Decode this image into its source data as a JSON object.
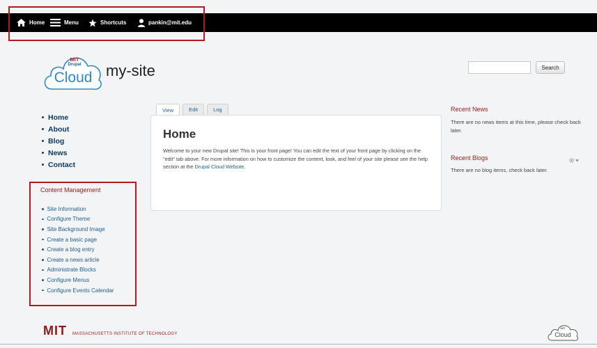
{
  "toolbar": {
    "home_label": "Home",
    "menu_label": "Menu",
    "shortcuts_label": "Shortcuts",
    "user_label": "pankin@mit.edu"
  },
  "site": {
    "logo_top": "MIT",
    "logo_mid": "Drupal",
    "logo_main": "Cloud",
    "name": "my-site"
  },
  "search": {
    "value": "",
    "placeholder": "",
    "button_label": "Search"
  },
  "main_nav": {
    "items": [
      {
        "label": "Home"
      },
      {
        "label": "About"
      },
      {
        "label": "Blog"
      },
      {
        "label": "News"
      },
      {
        "label": "Contact"
      }
    ]
  },
  "content_management": {
    "title": "Content Management",
    "items": [
      {
        "label": "Site Information"
      },
      {
        "label": "Configure Theme"
      },
      {
        "label": "Site Background Image"
      },
      {
        "label": "Create a basic page"
      },
      {
        "label": "Create a blog entry"
      },
      {
        "label": "Create a news article"
      },
      {
        "label": "Administrate Blocks"
      },
      {
        "label": "Configure Menus"
      },
      {
        "label": "Configure Events Calendar"
      }
    ]
  },
  "tabs": [
    {
      "label": "View",
      "active": true
    },
    {
      "label": "Edit",
      "active": false
    },
    {
      "label": "Log",
      "active": false
    }
  ],
  "page": {
    "title": "Home",
    "body_before_link": "Welcome to your new Drupal site! This is your front page! You can edit the text of your front page by clicking on the \"edit\" tab above. For more information on how to customize the content, look, and feel of your site please see the help section at the ",
    "body_link": "Drupal Cloud Website",
    "body_after_link": "."
  },
  "recent_news": {
    "title": "Recent News",
    "text": "There are no news items at this time, please check back later."
  },
  "recent_blogs": {
    "title": "Recent Blogs",
    "text": "There are no blog items, check back later."
  },
  "footer": {
    "logo_text": "MIT",
    "institute": "MASSACHUSETTS INSTITUTE OF TECHNOLOGY",
    "cloud_top": "MIT",
    "cloud_main": "Cloud"
  },
  "colors": {
    "accent_red": "#8f1a1a",
    "link_blue": "#1d5f8f",
    "nav_navy": "#0d3a63",
    "toolbar_bg": "#000000",
    "highlight_box": "#b0191e"
  }
}
